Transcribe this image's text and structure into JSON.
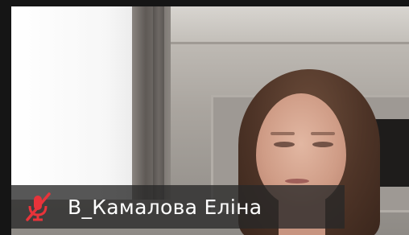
{
  "participant": {
    "name": "В_Камалова Еліна",
    "mic_status": "muted",
    "mic_icon": "mic-muted-icon"
  },
  "colors": {
    "name_bar_bg": "#282828",
    "name_text": "#ffffff",
    "muted_icon": "#e8333a"
  }
}
